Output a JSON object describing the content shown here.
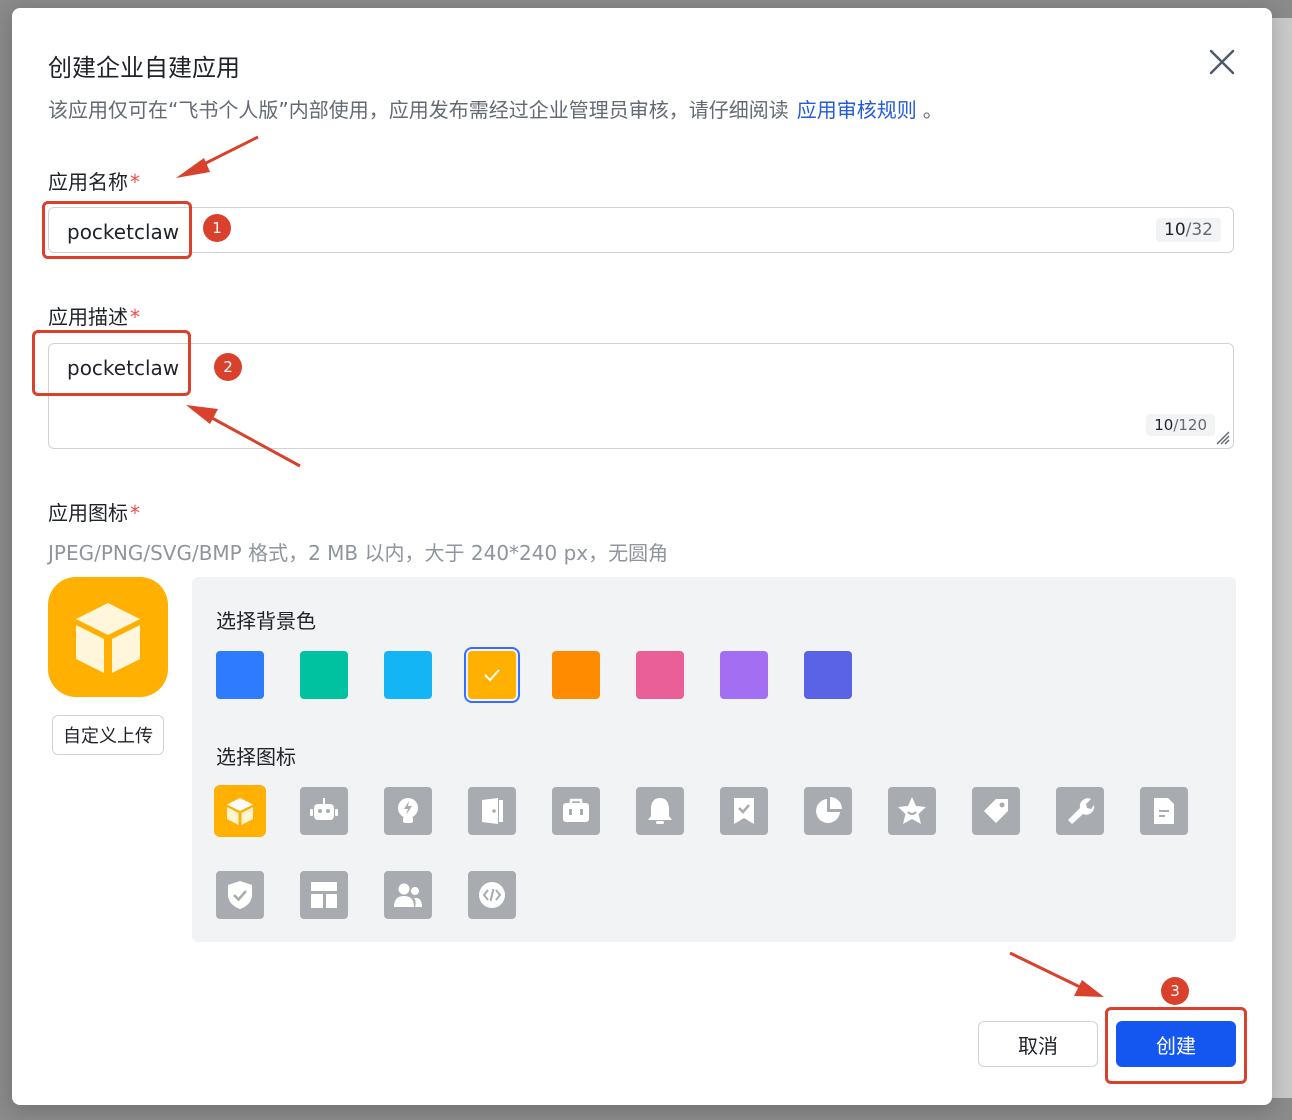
{
  "dialog": {
    "title": "创建企业自建应用",
    "subtitle": "该应用仅可在“飞书个人版”内部使用，应用发布需经过企业管理员审核，请仔细阅读",
    "subtitle_link": "应用审核规则",
    "subtitle_end": "。"
  },
  "name_field": {
    "label": "应用名称",
    "required_mark": "*",
    "value": "pocketclaw",
    "count": "10",
    "max": "/32"
  },
  "desc_field": {
    "label": "应用描述",
    "required_mark": "*",
    "value": "pocketclaw",
    "count": "10",
    "max": "/120"
  },
  "icon_field": {
    "label": "应用图标",
    "required_mark": "*",
    "hint": "JPEG/PNG/SVG/BMP 格式，2 MB 以内，大于 240*240 px，无圆角",
    "upload_label": "自定义上传",
    "bg_label": "选择背景色",
    "icon_label": "选择图标",
    "selected_color": "#ffb000",
    "colors": [
      "#2e7bff",
      "#00c2a0",
      "#14b5f5",
      "#ffb000",
      "#ff8b00",
      "#ea5f97",
      "#a36ef2",
      "#5a62e6"
    ],
    "icons": [
      "cube-icon",
      "robot-icon",
      "lightbulb-icon",
      "door-icon",
      "briefcase-icon",
      "bell-icon",
      "bookmark-check-icon",
      "pie-chart-icon",
      "star-icon",
      "tag-icon",
      "wrench-icon",
      "document-icon",
      "shield-check-icon",
      "layout-icon",
      "users-icon",
      "code-icon"
    ]
  },
  "buttons": {
    "cancel": "取消",
    "create": "创建"
  },
  "annotations": {
    "step1": "1",
    "step2": "2",
    "step3": "3",
    "accent": "#d9412c"
  }
}
